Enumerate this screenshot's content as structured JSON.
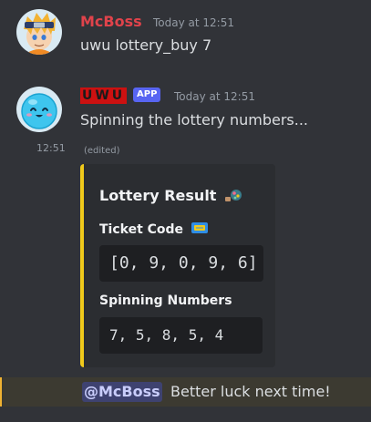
{
  "messages": [
    {
      "author": "McBoss",
      "author_color": "#e0434b",
      "timestamp": "Today at 12:51",
      "content": "uwu lottery_buy 7"
    },
    {
      "author": "UWU",
      "author_color": "#e0434b",
      "badge": "APP",
      "timestamp": "Today at 12:51",
      "content": "Spinning the lottery numbers...",
      "compact_timestamp": "12:51",
      "edited_label": "(edited)",
      "embed": {
        "accent_color": "#f0c91b",
        "title": "Lottery Result",
        "fields": [
          {
            "name": "Ticket Code",
            "value": "[0, 9, 0, 9, 6]"
          },
          {
            "name": "Spinning Numbers",
            "value": "7, 5, 8, 5, 4"
          }
        ]
      },
      "followup": {
        "mention": "@McBoss",
        "text": "Better luck next time!"
      }
    }
  ]
}
